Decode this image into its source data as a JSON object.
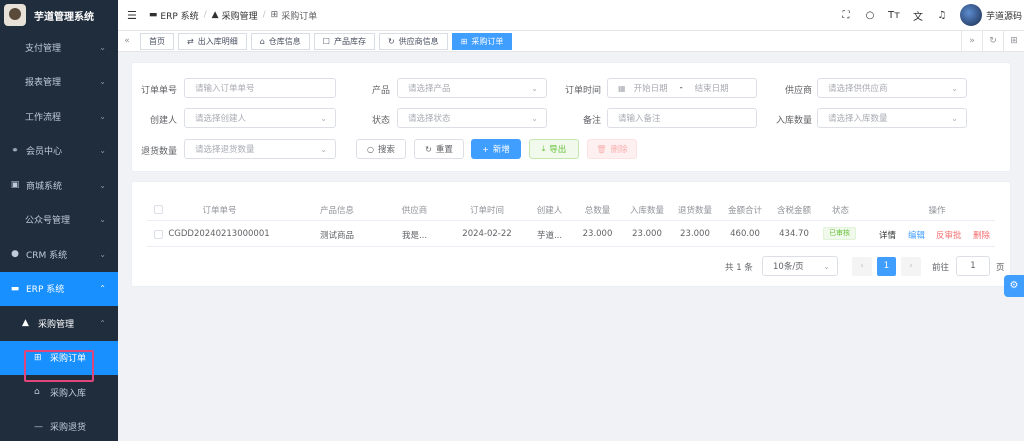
{
  "app": {
    "title": "芋道管理系统"
  },
  "sidebar": {
    "items": [
      {
        "label": "支付管理"
      },
      {
        "label": "报表管理"
      },
      {
        "label": "工作流程"
      },
      {
        "label": "会员中心",
        "icon": "members-icon"
      },
      {
        "label": "商城系统",
        "icon": "shop-icon"
      },
      {
        "label": "公众号管理"
      },
      {
        "label": "CRM 系统",
        "icon": "person-icon"
      },
      {
        "label": "ERP 系统",
        "icon": "erp-icon"
      },
      {
        "label": "采购管理",
        "icon": "letter-a-icon"
      },
      {
        "label": "采购订单",
        "icon": "grid-icon"
      },
      {
        "label": "采购入库",
        "icon": "warehouse-icon"
      },
      {
        "label": "采购退货",
        "icon": "dash-icon"
      }
    ]
  },
  "navbar": {
    "breadcrumb": [
      "ERP 系统",
      "采购管理",
      "采购订单"
    ],
    "user_name": "芋道源码"
  },
  "tags": [
    "首页",
    "出入库明细",
    "仓库信息",
    "产品库存",
    "供应商信息",
    "采购订单"
  ],
  "search": {
    "fields": {
      "order_no": {
        "label": "订单单号",
        "placeholder": "请输入订单单号"
      },
      "product": {
        "label": "产品",
        "placeholder": "请选择产品"
      },
      "order_time": {
        "label": "订单时间",
        "start": "开始日期",
        "sep": "-",
        "end": "结束日期"
      },
      "supplier": {
        "label": "供应商",
        "placeholder": "请选择供供应商"
      },
      "creator": {
        "label": "创建人",
        "placeholder": "请选择创建人"
      },
      "status": {
        "label": "状态",
        "placeholder": "请选择状态"
      },
      "remark": {
        "label": "备注",
        "placeholder": "请输入备注"
      },
      "in_count": {
        "label": "入库数量",
        "placeholder": "请选择入库数量"
      },
      "return_count": {
        "label": "退货数量",
        "placeholder": "请选择退货数量"
      }
    },
    "buttons": {
      "search": "搜索",
      "reset": "重置",
      "add": "新增",
      "export": "导出",
      "delete": "删除"
    }
  },
  "table": {
    "headers": [
      "订单单号",
      "产品信息",
      "供应商",
      "订单时间",
      "创建人",
      "总数量",
      "入库数量",
      "退货数量",
      "金额合计",
      "含税金额",
      "状态",
      "操作"
    ],
    "rows": [
      {
        "order_no": "CGDD20240213000001",
        "product": "测试商品",
        "supplier": "我是...",
        "time": "2024-02-22",
        "creator": "芋道...",
        "total": "23.000",
        "in_count": "23.000",
        "return_count": "23.000",
        "amount": "460.00",
        "tax_amount": "434.70",
        "status": "已审核",
        "actions": {
          "detail": "详情",
          "edit": "编辑",
          "unapprove": "反审批",
          "delete": "删除"
        }
      }
    ]
  },
  "pagination": {
    "total": "共 1 条",
    "page_size": "10条/页",
    "current": "1",
    "jump_label": "前往",
    "jump_value": "1",
    "jump_suffix": "页"
  },
  "colors": {
    "primary": "#409eff",
    "sidebar_bg": "#1f2d3d",
    "success": "#67c23a",
    "danger": "#f56c6c",
    "highlight": "#e0467c"
  }
}
